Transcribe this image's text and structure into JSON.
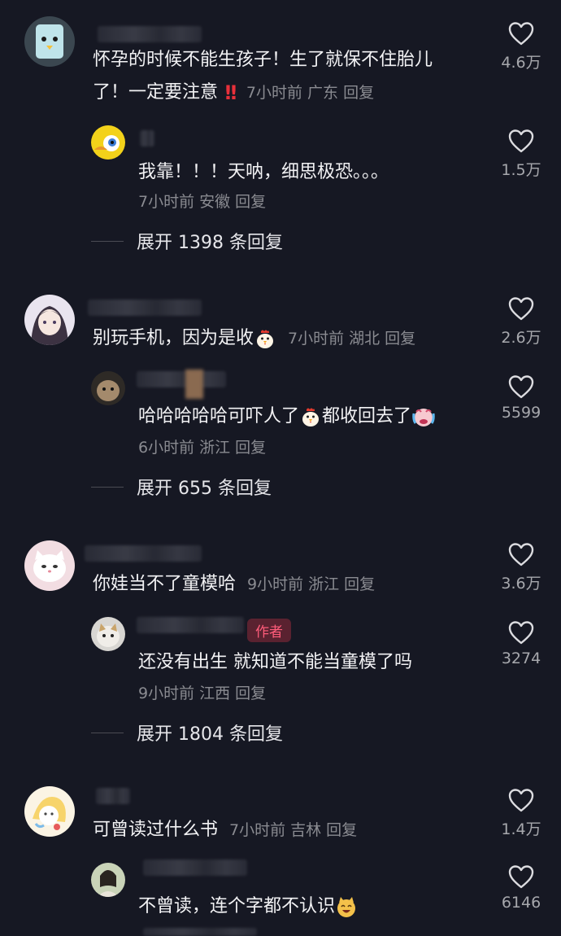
{
  "comments": [
    {
      "text": "怀孕的时候不能生孩子！生了就保不住胎儿了！一定要注意",
      "line1": "怀孕的时候不能生孩子！生了就保不住胎儿",
      "line2": "了！一定要注意",
      "emoji": "‼️",
      "meta": "7小时前 广东 回复",
      "likes": "4.6万",
      "reply": {
        "text": "我靠！！！天呐，细思极恐。。。",
        "meta": "7小时前 安徽 回复",
        "likes": "1.5万"
      },
      "expand": "展开 1398 条回复"
    },
    {
      "text": "别玩手机，因为是收",
      "meta": "7小时前 湖北 回复",
      "likes": "2.6万",
      "reply": {
        "text_a": "哈哈哈哈哈可吓人了",
        "text_b": "都收回去了",
        "meta": "6小时前 浙江 回复",
        "likes": "5599"
      },
      "expand": "展开 655 条回复"
    },
    {
      "text": "你娃当不了童模哈",
      "meta": "9小时前 浙江 回复",
      "likes": "3.6万",
      "reply": {
        "badge": "作者",
        "text": "还没有出生 就知道不能当童模了吗",
        "meta": "9小时前 江西 回复",
        "likes": "3274"
      },
      "expand": "展开 1804 条回复"
    },
    {
      "text": "可曾读过什么书",
      "meta": "7小时前 吉林 回复",
      "likes": "1.4万",
      "reply": {
        "text": "不曾读，连个字都不认识",
        "likes": "6146"
      }
    }
  ],
  "colors": {
    "background": "#161823",
    "meta": "#8a8b91",
    "author_badge": "#ff5c7a"
  }
}
